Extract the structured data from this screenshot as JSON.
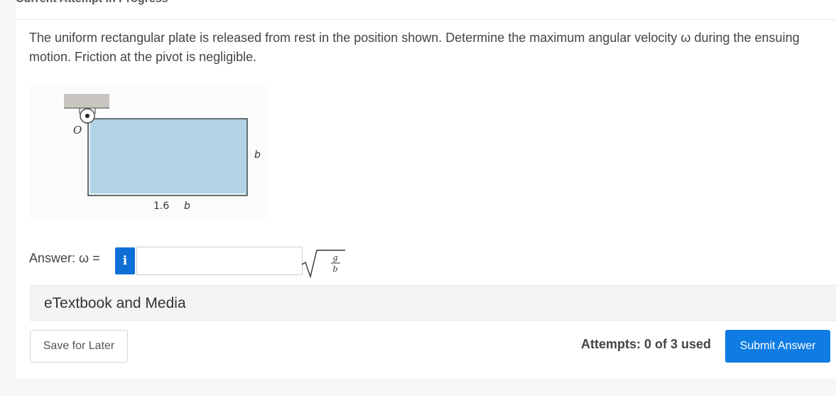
{
  "header": {
    "title": "Current Attempt in Progress"
  },
  "question": {
    "text": "The uniform rectangular plate is released from rest in the position shown. Determine the maximum angular velocity ω during the ensuing motion. Friction at the pivot is negligible."
  },
  "figure": {
    "pivot_label": "O",
    "width_label": "1.6",
    "width_var": "b",
    "height_label": "b",
    "plate_color": "#b3d3e5",
    "support_color": "#c8c4bf"
  },
  "answer": {
    "label": "Answer: ω =",
    "info_icon": "i",
    "value": "",
    "unit_numerator": "g",
    "unit_denominator": "b"
  },
  "etextbook": {
    "label": "eTextbook and Media"
  },
  "footer": {
    "save_label": "Save for Later",
    "attempts_text": "Attempts: 0 of 3 used",
    "submit_label": "Submit Answer"
  },
  "colors": {
    "accent": "#0f7ce3",
    "info": "#0f6fd6"
  }
}
